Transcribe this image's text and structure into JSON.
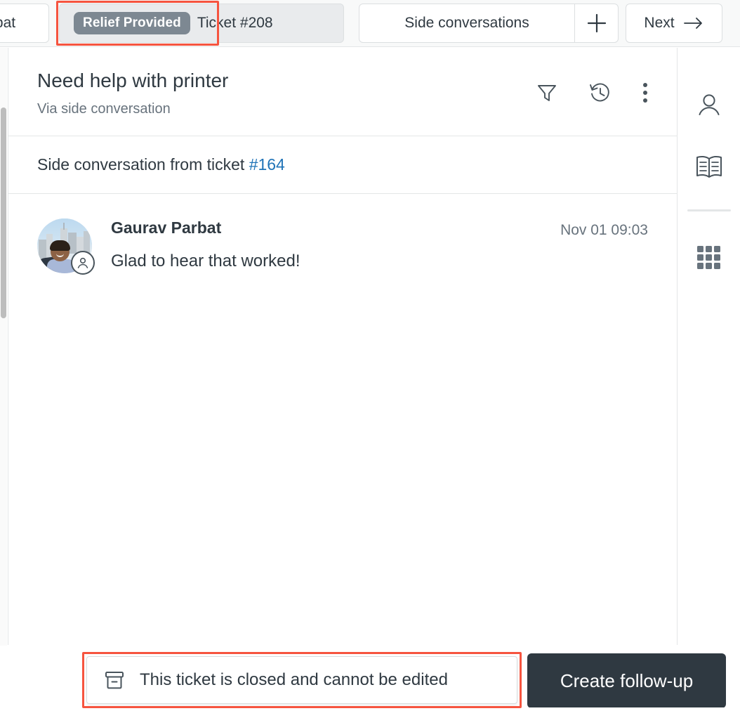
{
  "tabbar": {
    "prev_tab_label": "rbat",
    "active_tab": {
      "badge": "Relief Provided",
      "ticket_label": "Ticket #208"
    },
    "side_conversations_label": "Side conversations",
    "add_icon": "plus-icon",
    "next_label": "Next",
    "next_icon": "arrow-right-icon"
  },
  "ticket": {
    "title": "Need help with printer",
    "subtitle": "Via side conversation",
    "header_icons": [
      "filter-icon",
      "history-icon",
      "more-vertical-icon"
    ],
    "side_conversation_prefix": "Side conversation from ticket ",
    "side_conversation_ticket": "#164"
  },
  "message": {
    "author": "Gaurav Parbat",
    "timestamp": "Nov 01 09:03",
    "text": "Glad to hear that worked!",
    "avatar_badge_icon": "user-circle-icon"
  },
  "right_rail": {
    "items": [
      {
        "icon": "user-icon"
      },
      {
        "icon": "knowledge-base-icon"
      },
      {
        "icon": "apps-grid-icon"
      }
    ]
  },
  "footer": {
    "closed_notice_icon": "archive-icon",
    "closed_notice": "This ticket is closed and cannot be edited",
    "create_followup_label": "Create follow-up"
  },
  "colors": {
    "accent_link": "#1f73b7",
    "badge_pill": "#7d8892",
    "annotation": "#f6543f",
    "primary_button": "#2f3941",
    "text_primary": "#2f3941",
    "text_muted": "#68737d"
  }
}
